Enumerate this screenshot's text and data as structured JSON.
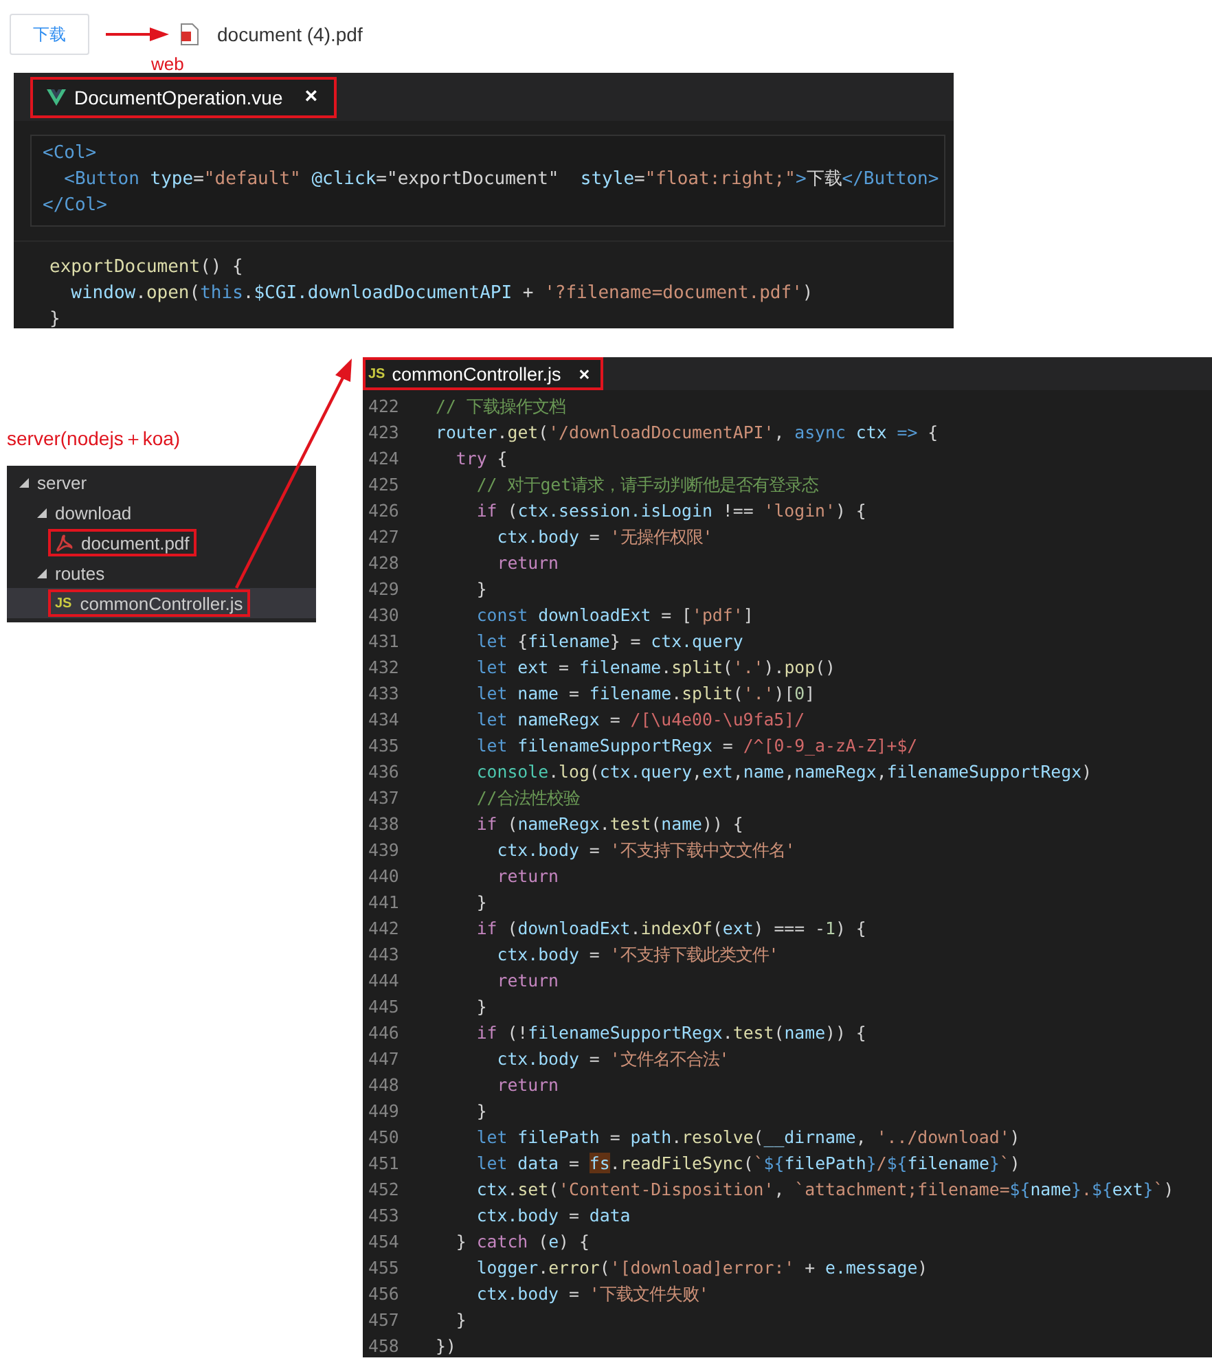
{
  "download_button": {
    "label": "下载"
  },
  "downloaded_file": {
    "name": "document (4).pdf"
  },
  "web_label": "web",
  "vue_editor": {
    "tab": {
      "title": "DocumentOperation.vue",
      "close": "×",
      "boxed": true
    },
    "template_lines": [
      {
        "tokens": [
          {
            "kind": "tag",
            "text": "<Col>"
          }
        ]
      },
      {
        "tokens": [
          {
            "kind": "tag",
            "text": "  <Button"
          },
          {
            "kind": "attr",
            "text": " type"
          },
          {
            "kind": "plain",
            "text": "="
          },
          {
            "kind": "string",
            "text": "\"default\""
          },
          {
            "kind": "attr",
            "text": " @click"
          },
          {
            "kind": "plain",
            "text": "=\"exportDocument\""
          },
          {
            "kind": "attr",
            "text": "  style"
          },
          {
            "kind": "plain",
            "text": "="
          },
          {
            "kind": "string",
            "text": "\"float:right;\""
          },
          {
            "kind": "tag",
            "text": ">"
          },
          {
            "kind": "plain",
            "text": "下载"
          },
          {
            "kind": "tag",
            "text": "</Button>"
          }
        ]
      },
      {
        "tokens": [
          {
            "kind": "tag",
            "text": "</Col>"
          }
        ]
      }
    ],
    "script_lines": [
      {
        "tokens": [
          {
            "kind": "function",
            "text": "exportDocument"
          },
          {
            "kind": "plain",
            "text": "() {"
          }
        ]
      },
      {
        "tokens": [
          {
            "kind": "variable",
            "text": "  window"
          },
          {
            "kind": "plain",
            "text": "."
          },
          {
            "kind": "function",
            "text": "open"
          },
          {
            "kind": "plain",
            "text": "("
          },
          {
            "kind": "keyword",
            "text": "this"
          },
          {
            "kind": "plain",
            "text": "."
          },
          {
            "kind": "variable",
            "text": "$CGI.downloadDocumentAPI"
          },
          {
            "kind": "plain",
            "text": " + "
          },
          {
            "kind": "string",
            "text": "'?filename=document.pdf'"
          },
          {
            "kind": "plain",
            "text": ")"
          }
        ]
      },
      {
        "tokens": [
          {
            "kind": "plain",
            "text": "}"
          }
        ]
      }
    ]
  },
  "server_label": "server(nodejs＋koa)",
  "explorer": {
    "items": [
      {
        "label": "server",
        "kind": "folder",
        "expanded": true,
        "selected": false,
        "boxed": false,
        "children": [
          {
            "label": "download",
            "kind": "folder",
            "expanded": true,
            "selected": false,
            "boxed": false,
            "children": [
              {
                "label": "document.pdf",
                "kind": "pdf",
                "selected": false,
                "boxed": true
              }
            ]
          },
          {
            "label": "routes",
            "kind": "folder",
            "expanded": true,
            "selected": false,
            "boxed": false,
            "children": [
              {
                "label": "commonController.js",
                "kind": "js",
                "badge": "JS",
                "selected": true,
                "boxed": true
              }
            ]
          }
        ]
      }
    ]
  },
  "code_editor": {
    "tab": {
      "title": "commonController.js",
      "badge": "JS",
      "close": "×",
      "boxed": true
    },
    "lines": [
      {
        "number": "422",
        "tokens": [
          {
            "kind": "comment",
            "text": "// 下载操作文档"
          }
        ]
      },
      {
        "number": "423",
        "tokens": [
          {
            "kind": "variable",
            "text": "router"
          },
          {
            "kind": "plain",
            "text": "."
          },
          {
            "kind": "function",
            "text": "get"
          },
          {
            "kind": "plain",
            "text": "("
          },
          {
            "kind": "string",
            "text": "'/downloadDocumentAPI'"
          },
          {
            "kind": "plain",
            "text": ", "
          },
          {
            "kind": "keyword",
            "text": "async"
          },
          {
            "kind": "variable",
            "text": " ctx"
          },
          {
            "kind": "keyword",
            "text": " =>"
          },
          {
            "kind": "plain",
            "text": " {"
          }
        ]
      },
      {
        "number": "424",
        "tokens": [
          {
            "kind": "control",
            "text": "  try"
          },
          {
            "kind": "plain",
            "text": " {"
          }
        ]
      },
      {
        "number": "425",
        "tokens": [
          {
            "kind": "comment",
            "text": "    // 对于get请求，请手动判断他是否有登录态"
          }
        ]
      },
      {
        "number": "426",
        "tokens": [
          {
            "kind": "control",
            "text": "    if"
          },
          {
            "kind": "plain",
            "text": " ("
          },
          {
            "kind": "variable",
            "text": "ctx.session.isLogin"
          },
          {
            "kind": "plain",
            "text": " !== "
          },
          {
            "kind": "string",
            "text": "'login'"
          },
          {
            "kind": "plain",
            "text": ") {"
          }
        ]
      },
      {
        "number": "427",
        "tokens": [
          {
            "kind": "variable",
            "text": "      ctx.body"
          },
          {
            "kind": "plain",
            "text": " = "
          },
          {
            "kind": "string",
            "text": "'无操作权限'"
          }
        ]
      },
      {
        "number": "428",
        "tokens": [
          {
            "kind": "control",
            "text": "      return"
          }
        ]
      },
      {
        "number": "429",
        "tokens": [
          {
            "kind": "plain",
            "text": "    }"
          }
        ]
      },
      {
        "number": "430",
        "tokens": [
          {
            "kind": "keyword",
            "text": "    const"
          },
          {
            "kind": "variable",
            "text": " downloadExt"
          },
          {
            "kind": "plain",
            "text": " = ["
          },
          {
            "kind": "string",
            "text": "'pdf'"
          },
          {
            "kind": "plain",
            "text": "]"
          }
        ]
      },
      {
        "number": "431",
        "tokens": [
          {
            "kind": "keyword",
            "text": "    let"
          },
          {
            "kind": "plain",
            "text": " {"
          },
          {
            "kind": "variable",
            "text": "filename"
          },
          {
            "kind": "plain",
            "text": "} = "
          },
          {
            "kind": "variable",
            "text": "ctx.query"
          }
        ]
      },
      {
        "number": "432",
        "tokens": [
          {
            "kind": "keyword",
            "text": "    let"
          },
          {
            "kind": "variable",
            "text": " ext"
          },
          {
            "kind": "plain",
            "text": " = "
          },
          {
            "kind": "variable",
            "text": "filename"
          },
          {
            "kind": "plain",
            "text": "."
          },
          {
            "kind": "function",
            "text": "split"
          },
          {
            "kind": "plain",
            "text": "("
          },
          {
            "kind": "string",
            "text": "'.'"
          },
          {
            "kind": "plain",
            "text": ")."
          },
          {
            "kind": "function",
            "text": "pop"
          },
          {
            "kind": "plain",
            "text": "()"
          }
        ]
      },
      {
        "number": "433",
        "tokens": [
          {
            "kind": "keyword",
            "text": "    let"
          },
          {
            "kind": "variable",
            "text": " name"
          },
          {
            "kind": "plain",
            "text": " = "
          },
          {
            "kind": "variable",
            "text": "filename"
          },
          {
            "kind": "plain",
            "text": "."
          },
          {
            "kind": "function",
            "text": "split"
          },
          {
            "kind": "plain",
            "text": "("
          },
          {
            "kind": "string",
            "text": "'.'"
          },
          {
            "kind": "plain",
            "text": ")["
          },
          {
            "kind": "number",
            "text": "0"
          },
          {
            "kind": "plain",
            "text": "]"
          }
        ]
      },
      {
        "number": "434",
        "tokens": [
          {
            "kind": "keyword",
            "text": "    let"
          },
          {
            "kind": "variable",
            "text": " nameRegx"
          },
          {
            "kind": "plain",
            "text": " = "
          },
          {
            "kind": "regex",
            "text": "/[\\u4e00-\\u9fa5]/"
          }
        ]
      },
      {
        "number": "435",
        "tokens": [
          {
            "kind": "keyword",
            "text": "    let"
          },
          {
            "kind": "variable",
            "text": " filenameSupportRegx"
          },
          {
            "kind": "plain",
            "text": " = "
          },
          {
            "kind": "regex",
            "text": "/^[0-9_a-zA-Z]+$/"
          }
        ]
      },
      {
        "number": "436",
        "tokens": [
          {
            "kind": "type",
            "text": "    console"
          },
          {
            "kind": "plain",
            "text": "."
          },
          {
            "kind": "function",
            "text": "log"
          },
          {
            "kind": "plain",
            "text": "("
          },
          {
            "kind": "variable",
            "text": "ctx.query"
          },
          {
            "kind": "plain",
            "text": ","
          },
          {
            "kind": "variable",
            "text": "ext"
          },
          {
            "kind": "plain",
            "text": ","
          },
          {
            "kind": "variable",
            "text": "name"
          },
          {
            "kind": "plain",
            "text": ","
          },
          {
            "kind": "variable",
            "text": "nameRegx"
          },
          {
            "kind": "plain",
            "text": ","
          },
          {
            "kind": "variable",
            "text": "filenameSupportRegx"
          },
          {
            "kind": "plain",
            "text": ")"
          }
        ]
      },
      {
        "number": "437",
        "tokens": [
          {
            "kind": "comment",
            "text": "    //合法性校验"
          }
        ]
      },
      {
        "number": "438",
        "tokens": [
          {
            "kind": "control",
            "text": "    if"
          },
          {
            "kind": "plain",
            "text": " ("
          },
          {
            "kind": "variable",
            "text": "nameRegx"
          },
          {
            "kind": "plain",
            "text": "."
          },
          {
            "kind": "function",
            "text": "test"
          },
          {
            "kind": "plain",
            "text": "("
          },
          {
            "kind": "variable",
            "text": "name"
          },
          {
            "kind": "plain",
            "text": ")) {"
          }
        ]
      },
      {
        "number": "439",
        "tokens": [
          {
            "kind": "variable",
            "text": "      ctx.body"
          },
          {
            "kind": "plain",
            "text": " = "
          },
          {
            "kind": "string",
            "text": "'不支持下载中文文件名'"
          }
        ]
      },
      {
        "number": "440",
        "tokens": [
          {
            "kind": "control",
            "text": "      return"
          }
        ]
      },
      {
        "number": "441",
        "tokens": [
          {
            "kind": "plain",
            "text": "    }"
          }
        ]
      },
      {
        "number": "442",
        "tokens": [
          {
            "kind": "control",
            "text": "    if"
          },
          {
            "kind": "plain",
            "text": " ("
          },
          {
            "kind": "variable",
            "text": "downloadExt"
          },
          {
            "kind": "plain",
            "text": "."
          },
          {
            "kind": "function",
            "text": "indexOf"
          },
          {
            "kind": "plain",
            "text": "("
          },
          {
            "kind": "variable",
            "text": "ext"
          },
          {
            "kind": "plain",
            "text": ") === -"
          },
          {
            "kind": "number",
            "text": "1"
          },
          {
            "kind": "plain",
            "text": ") {"
          }
        ]
      },
      {
        "number": "443",
        "tokens": [
          {
            "kind": "variable",
            "text": "      ctx.body"
          },
          {
            "kind": "plain",
            "text": " = "
          },
          {
            "kind": "string",
            "text": "'不支持下载此类文件'"
          }
        ]
      },
      {
        "number": "444",
        "tokens": [
          {
            "kind": "control",
            "text": "      return"
          }
        ]
      },
      {
        "number": "445",
        "tokens": [
          {
            "kind": "plain",
            "text": "    }"
          }
        ]
      },
      {
        "number": "446",
        "tokens": [
          {
            "kind": "control",
            "text": "    if"
          },
          {
            "kind": "plain",
            "text": " (!"
          },
          {
            "kind": "variable",
            "text": "filenameSupportRegx"
          },
          {
            "kind": "plain",
            "text": "."
          },
          {
            "kind": "function",
            "text": "test"
          },
          {
            "kind": "plain",
            "text": "("
          },
          {
            "kind": "variable",
            "text": "name"
          },
          {
            "kind": "plain",
            "text": ")) {"
          }
        ]
      },
      {
        "number": "447",
        "tokens": [
          {
            "kind": "variable",
            "text": "      ctx.body"
          },
          {
            "kind": "plain",
            "text": " = "
          },
          {
            "kind": "string",
            "text": "'文件名不合法'"
          }
        ]
      },
      {
        "number": "448",
        "tokens": [
          {
            "kind": "control",
            "text": "      return"
          }
        ]
      },
      {
        "number": "449",
        "tokens": [
          {
            "kind": "plain",
            "text": "    }"
          }
        ]
      },
      {
        "number": "450",
        "tokens": [
          {
            "kind": "keyword",
            "text": "    let"
          },
          {
            "kind": "variable",
            "text": " filePath"
          },
          {
            "kind": "plain",
            "text": " = "
          },
          {
            "kind": "variable",
            "text": "path"
          },
          {
            "kind": "plain",
            "text": "."
          },
          {
            "kind": "function",
            "text": "resolve"
          },
          {
            "kind": "plain",
            "text": "("
          },
          {
            "kind": "variable",
            "text": "__dirname"
          },
          {
            "kind": "plain",
            "text": ", "
          },
          {
            "kind": "string",
            "text": "'../download'"
          },
          {
            "kind": "plain",
            "text": ")"
          }
        ]
      },
      {
        "number": "451",
        "tokens": [
          {
            "kind": "keyword",
            "text": "    let"
          },
          {
            "kind": "variable",
            "text": " data"
          },
          {
            "kind": "plain",
            "text": " = "
          },
          {
            "kind": "match",
            "text": "fs"
          },
          {
            "kind": "plain",
            "text": "."
          },
          {
            "kind": "function",
            "text": "readFileSync"
          },
          {
            "kind": "plain",
            "text": "("
          },
          {
            "kind": "string",
            "text": "`"
          },
          {
            "kind": "keyword",
            "text": "${"
          },
          {
            "kind": "variable",
            "text": "filePath"
          },
          {
            "kind": "keyword",
            "text": "}"
          },
          {
            "kind": "string",
            "text": "/"
          },
          {
            "kind": "keyword",
            "text": "${"
          },
          {
            "kind": "variable",
            "text": "filename"
          },
          {
            "kind": "keyword",
            "text": "}"
          },
          {
            "kind": "string",
            "text": "`"
          },
          {
            "kind": "plain",
            "text": ")"
          }
        ]
      },
      {
        "number": "452",
        "tokens": [
          {
            "kind": "variable",
            "text": "    ctx"
          },
          {
            "kind": "plain",
            "text": "."
          },
          {
            "kind": "function",
            "text": "set"
          },
          {
            "kind": "plain",
            "text": "("
          },
          {
            "kind": "string",
            "text": "'Content-Disposition'"
          },
          {
            "kind": "plain",
            "text": ", "
          },
          {
            "kind": "string",
            "text": "`attachment;filename="
          },
          {
            "kind": "keyword",
            "text": "${"
          },
          {
            "kind": "variable",
            "text": "name"
          },
          {
            "kind": "keyword",
            "text": "}"
          },
          {
            "kind": "string",
            "text": "."
          },
          {
            "kind": "keyword",
            "text": "${"
          },
          {
            "kind": "variable",
            "text": "ext"
          },
          {
            "kind": "keyword",
            "text": "}"
          },
          {
            "kind": "string",
            "text": "`"
          },
          {
            "kind": "plain",
            "text": ")"
          }
        ]
      },
      {
        "number": "453",
        "tokens": [
          {
            "kind": "variable",
            "text": "    ctx.body"
          },
          {
            "kind": "plain",
            "text": " = "
          },
          {
            "kind": "variable",
            "text": "data"
          }
        ]
      },
      {
        "number": "454",
        "tokens": [
          {
            "kind": "plain",
            "text": "  } "
          },
          {
            "kind": "control",
            "text": "catch"
          },
          {
            "kind": "plain",
            "text": " ("
          },
          {
            "kind": "variable",
            "text": "e"
          },
          {
            "kind": "plain",
            "text": ") {"
          }
        ]
      },
      {
        "number": "455",
        "tokens": [
          {
            "kind": "variable",
            "text": "    logger"
          },
          {
            "kind": "plain",
            "text": "."
          },
          {
            "kind": "function",
            "text": "error"
          },
          {
            "kind": "plain",
            "text": "("
          },
          {
            "kind": "string",
            "text": "'[download]error:'"
          },
          {
            "kind": "plain",
            "text": " + "
          },
          {
            "kind": "variable",
            "text": "e.message"
          },
          {
            "kind": "plain",
            "text": ")"
          }
        ]
      },
      {
        "number": "456",
        "tokens": [
          {
            "kind": "variable",
            "text": "    ctx.body"
          },
          {
            "kind": "plain",
            "text": " = "
          },
          {
            "kind": "string",
            "text": "'下载文件失败'"
          }
        ]
      },
      {
        "number": "457",
        "tokens": [
          {
            "kind": "plain",
            "text": "  }"
          }
        ]
      },
      {
        "number": "458",
        "tokens": [
          {
            "kind": "plain",
            "text": "})"
          }
        ]
      }
    ]
  }
}
